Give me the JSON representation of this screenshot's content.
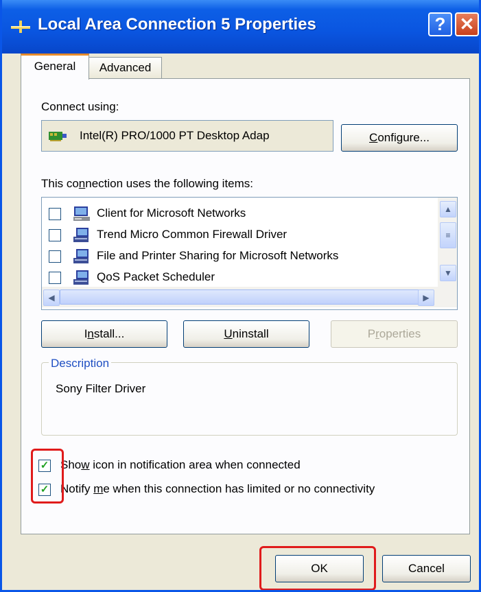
{
  "window": {
    "title": "Local Area Connection 5 Properties",
    "help": "?",
    "close": "✕"
  },
  "tabs": {
    "general": "General",
    "advanced": "Advanced"
  },
  "connect_using": {
    "label": "Connect using:",
    "adapter": "Intel(R) PRO/1000 PT Desktop Adap",
    "configure": "Configure..."
  },
  "items": {
    "label": "This connection uses the following items:",
    "list": [
      {
        "label": "Client for Microsoft Networks",
        "checked": false
      },
      {
        "label": "Trend Micro Common Firewall Driver",
        "checked": false
      },
      {
        "label": "File and Printer Sharing for Microsoft Networks",
        "checked": false
      },
      {
        "label": "QoS Packet Scheduler",
        "checked": false
      }
    ]
  },
  "buttons": {
    "install": "Install...",
    "uninstall": "Uninstall",
    "properties": "Properties",
    "ok": "OK",
    "cancel": "Cancel"
  },
  "description": {
    "title": "Description",
    "text": "Sony Filter Driver"
  },
  "options": {
    "show_icon": {
      "label": "Show icon in notification area when connected",
      "checked": true
    },
    "notify": {
      "label": "Notify me when this connection has limited or no connectivity",
      "checked": true
    }
  },
  "colors": {
    "titlebar": "#0a55e0",
    "highlight": "#e01b1b",
    "check": "#21a121"
  }
}
